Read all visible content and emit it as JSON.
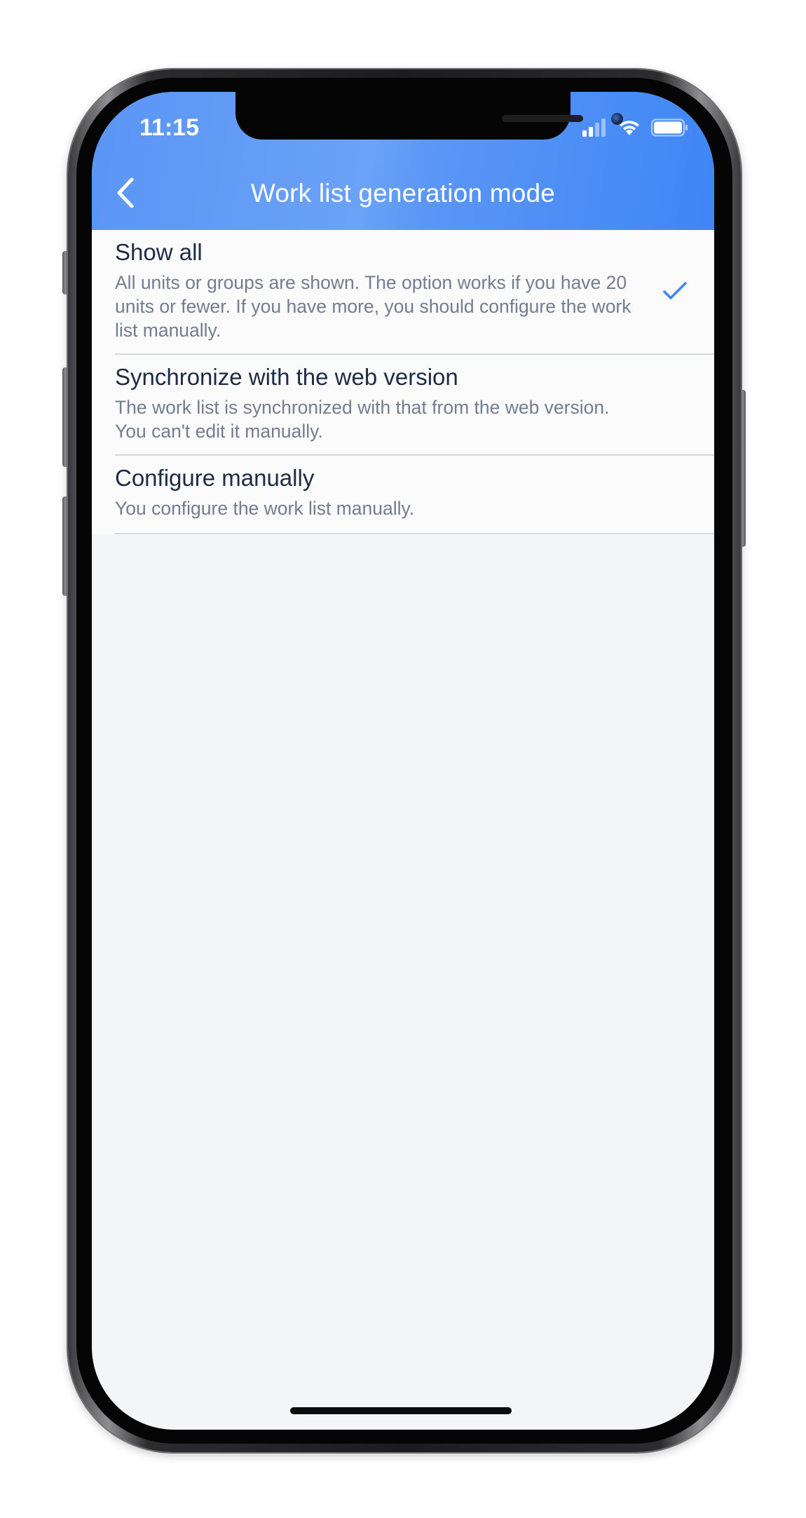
{
  "status_bar": {
    "time": "11:15",
    "icons": [
      "cellular-signal-icon",
      "wifi-icon",
      "battery-icon"
    ]
  },
  "header": {
    "title": "Work list generation mode",
    "back_icon": "chevron-left-icon",
    "background_color": "#4d8ef6"
  },
  "options": [
    {
      "title": "Show all",
      "description": "All units or groups are shown. The option works if you have 20 units or fewer. If you have more, you should configure the work list manually.",
      "selected": true
    },
    {
      "title": "Synchronize with the web version",
      "description": "The work list is synchronized with that from the web version. You can't edit it manually.",
      "selected": false
    },
    {
      "title": "Configure manually",
      "description": "You configure the work list manually.",
      "selected": false
    }
  ],
  "colors": {
    "accent": "#3d85f5",
    "title_text": "#1e2b45",
    "description_text": "#737d8f",
    "background": "#f4f5f7"
  }
}
